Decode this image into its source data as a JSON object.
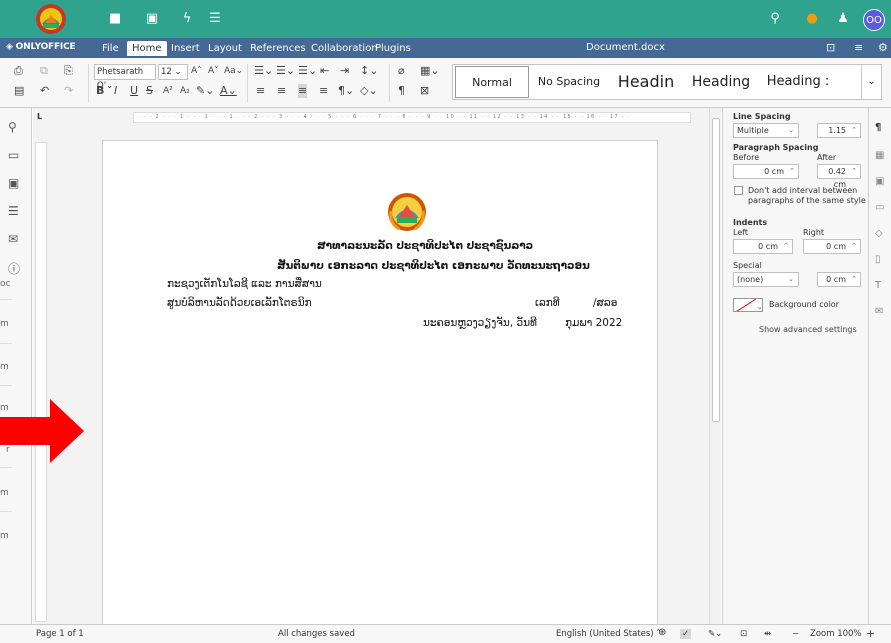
{
  "topbar": {
    "icons": [
      "folder-icon",
      "image-icon",
      "bolt-icon",
      "list-icon",
      "search-icon",
      "bell-icon",
      "user-add-icon"
    ],
    "avatar_initials": "OO"
  },
  "app": {
    "brand": "ONLYOFFICE",
    "tabs": [
      "File",
      "Home",
      "Insert",
      "Layout",
      "References",
      "Collaboration",
      "Plugins"
    ],
    "active_tab": "Home",
    "document_title": "Document.docx"
  },
  "toolbar": {
    "font_name": "Phetsarath O'",
    "font_size": "12",
    "styles": [
      "Normal",
      "No Spacing",
      "Headin",
      "Heading",
      "Heading :"
    ]
  },
  "ruler": {
    "marks": "· · · 2 · · · 1 · · · 1 · · · 1 · · · 2 · · · 3 · · · 4 · · · 5 · · · 6 · · · 7 · · · 8 · · · 9 · · 10 · · 11 · · 12 · · 13 · · 14 · · 15 · · 16 · · 17 · ·"
  },
  "outline": {
    "items": [
      "oc",
      "m",
      "m",
      "m",
      "r",
      "m",
      "m"
    ]
  },
  "document": {
    "line1": "ສາທາລະນະລັດ ປະຊາທິປະໄຕ ປະຊາຊົນລາວ",
    "line2": "ສັນຕິພາບ ເອກະລາດ ປະຊາທິປະໄຕ ເອກະພາບ ວັດທະນະຖາວອນ",
    "line3": "ກະຊວງເຕັກໂນໂລຊີ ແລະ ການສື່ສານ",
    "line4": "ສູນບໍລິຫານລັດດ້ວຍເອເລັກໂຕຣນິກ",
    "ref_label": "ເລກທີ",
    "ref_suffix": "/ສລອ",
    "date_line_prefix": "ນະຄອນຫຼວງວຽງຈັນ, ວັນທີ",
    "date_line_suffix": "ກຸມພາ 2022"
  },
  "panel": {
    "line_spacing_label": "Line Spacing",
    "line_spacing_type": "Multiple",
    "line_spacing_value": "1.15",
    "paragraph_spacing_label": "Paragraph Spacing",
    "before_label": "Before",
    "after_label": "After",
    "before_value": "0 cm",
    "after_value": "0.42 cm",
    "dont_add_interval": "Don't add interval between",
    "dont_add_interval_2": "paragraphs of the same style",
    "indents_label": "Indents",
    "left_label": "Left",
    "right_label": "Right",
    "left_value": "0 cm",
    "right_value": "0 cm",
    "special_label": "Special",
    "special_value": "(none)",
    "special_amount": "0 cm",
    "background_color_label": "Background color",
    "show_advanced": "Show advanced settings"
  },
  "statusbar": {
    "page": "Page 1 of 1",
    "save_status": "All changes saved",
    "language": "English (United States)",
    "zoom": "Zoom 100%"
  },
  "colors": {
    "topbar": "#2fa38e",
    "app_bar": "#446995",
    "arrow": "#ff0000",
    "avatar": "#5b5be0"
  }
}
